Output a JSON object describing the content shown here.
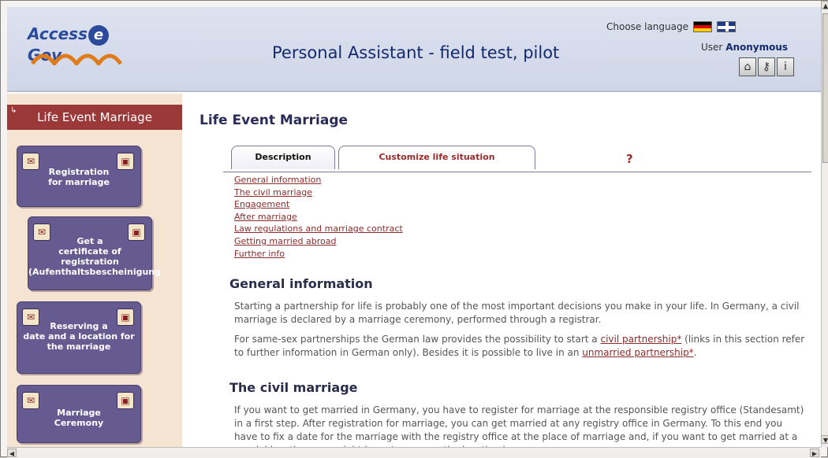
{
  "header": {
    "logo_text_left": "Access",
    "logo_text_e": "e",
    "logo_text_right": "Gov",
    "title": "Personal Assistant - field test, pilot",
    "language_label": "Choose language",
    "user_label": "User",
    "user_name": "Anonymous",
    "icons": [
      "home-icon",
      "key-icon",
      "info-icon"
    ]
  },
  "sidebar": {
    "heading": "Life Event Marriage",
    "steps": [
      {
        "label": "Registration\nfor marriage"
      },
      {
        "label": "Get a\ncertificate of registration\n(Aufenthaltsbescheinigung"
      },
      {
        "label": "Reserving a\ndate and a location for\nthe marriage"
      },
      {
        "label": "Marriage\nCeremony"
      }
    ]
  },
  "main": {
    "title": "Life Event Marriage",
    "tabs": [
      {
        "label": "Description"
      },
      {
        "label": "Customize life situation"
      }
    ],
    "help_glyph": "?",
    "toc": [
      "General information",
      "The civil marriage",
      "Engagement",
      "After marriage",
      "Law regulations and marriage contract",
      "Getting married abroad",
      "Further info"
    ],
    "sections": [
      {
        "title": "General information",
        "p1": "Starting a partnership for life is probably one of the most important decisions you make in your life. In Germany, a civil marriage is declared by a marriage ceremony, performed through a registrar.",
        "p2_a": "For same-sex partnerships the German law provides the possibility to start a ",
        "p2_link1": "civil partnership*",
        "p2_b": " (links in this section refer to further information in German only). Besides it is possible to live in an ",
        "p2_link2": "unmarried partnership*",
        "p2_c": "."
      },
      {
        "title": "The civil marriage",
        "p1": "If you want to get married in Germany, you have to register for marriage at the responsible registry office (Standesamt) in a first step. After registration for marriage, you can get married at any registry office in Germany. To this end you have to fix a date for the marriage with the registry office at the place of marriage and, if you want to get married at a special location, you might have to arrange the location in"
      }
    ]
  }
}
